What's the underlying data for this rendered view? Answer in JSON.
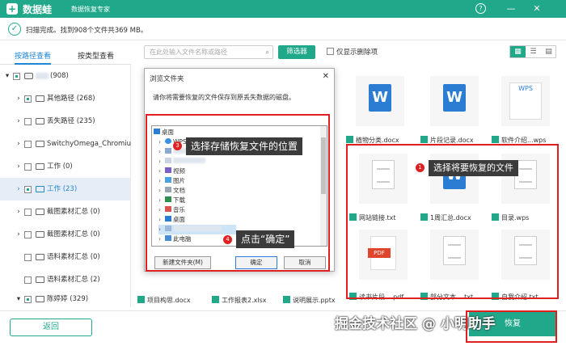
{
  "titlebar": {
    "app_name": "数据蛙",
    "app_subtitle": "数据恢复专家",
    "help": "?",
    "minimize": "—",
    "close": "✕"
  },
  "status": {
    "text": "扫描完成。找到908个文件共369 MB。"
  },
  "tabs": {
    "by_path": "按路径查看",
    "by_type": "按类型查看"
  },
  "search": {
    "placeholder": "在此处输入文件名称或路径",
    "icon": "search-icon"
  },
  "filter_label": "筛选器",
  "only_deleted_label": "仅显示删除项",
  "tree": [
    {
      "label": "(908)"
    },
    {
      "label": "其他路径 (268)"
    },
    {
      "label": "丢失路径 (235)"
    },
    {
      "label": "SwitchyOmega_Chromium"
    },
    {
      "label": "工作 (0)"
    },
    {
      "label": "工作 (23)"
    },
    {
      "label": "截图素材汇总 (0)"
    },
    {
      "label": "截图素材汇总 (0)"
    },
    {
      "label": "语料素材汇总 (0)"
    },
    {
      "label": "语料素材汇总 (2)"
    },
    {
      "label": "陈婷婷 (329)"
    }
  ],
  "files": [
    {
      "name": "植物分类.docx"
    },
    {
      "name": "片段记录.docx"
    },
    {
      "name": "软件介绍...wps"
    },
    {
      "name": "网站链接.txt"
    },
    {
      "name": "1周汇总.docx"
    },
    {
      "name": "目录.wps"
    },
    {
      "name": "读书片段....pdf"
    },
    {
      "name": "部分文本....txt"
    },
    {
      "name": "自我介绍.txt"
    },
    {
      "name": "项目构思.docx"
    },
    {
      "name": "工作报表2.xlsx"
    },
    {
      "name": "说明展示.pptx"
    }
  ],
  "wps_label": "WPS",
  "pdf_label": "PDF",
  "back_label": "返回",
  "recover_label": "恢复",
  "watermark": "掘金技术社区 @ 小明助手",
  "dialog": {
    "title": "浏览文件夹",
    "close": "✕",
    "description": "请你将需要恢复的文件保存到原丢失数据的磁盘。",
    "tree": [
      "桌面",
      "WPS网盘",
      "",
      "",
      "视频",
      "图片",
      "文档",
      "下载",
      "音乐",
      "桌面",
      "",
      "此电脑"
    ],
    "new_folder": "新建文件夹(M)",
    "ok": "确定",
    "cancel": "取消"
  },
  "callouts": {
    "step1": {
      "num": "1",
      "text": "选择将要恢复的文件"
    },
    "step3": {
      "num": "3",
      "text": "选择存储恢复文件的位置"
    },
    "step4": {
      "num": "4",
      "text": "点击“确定”"
    }
  },
  "colors": {
    "brand": "#21a88a",
    "accent": "#1f86d6",
    "annotation": "#e02020",
    "word_blue": "#2b7cd3",
    "pdf_red": "#e0452c"
  }
}
